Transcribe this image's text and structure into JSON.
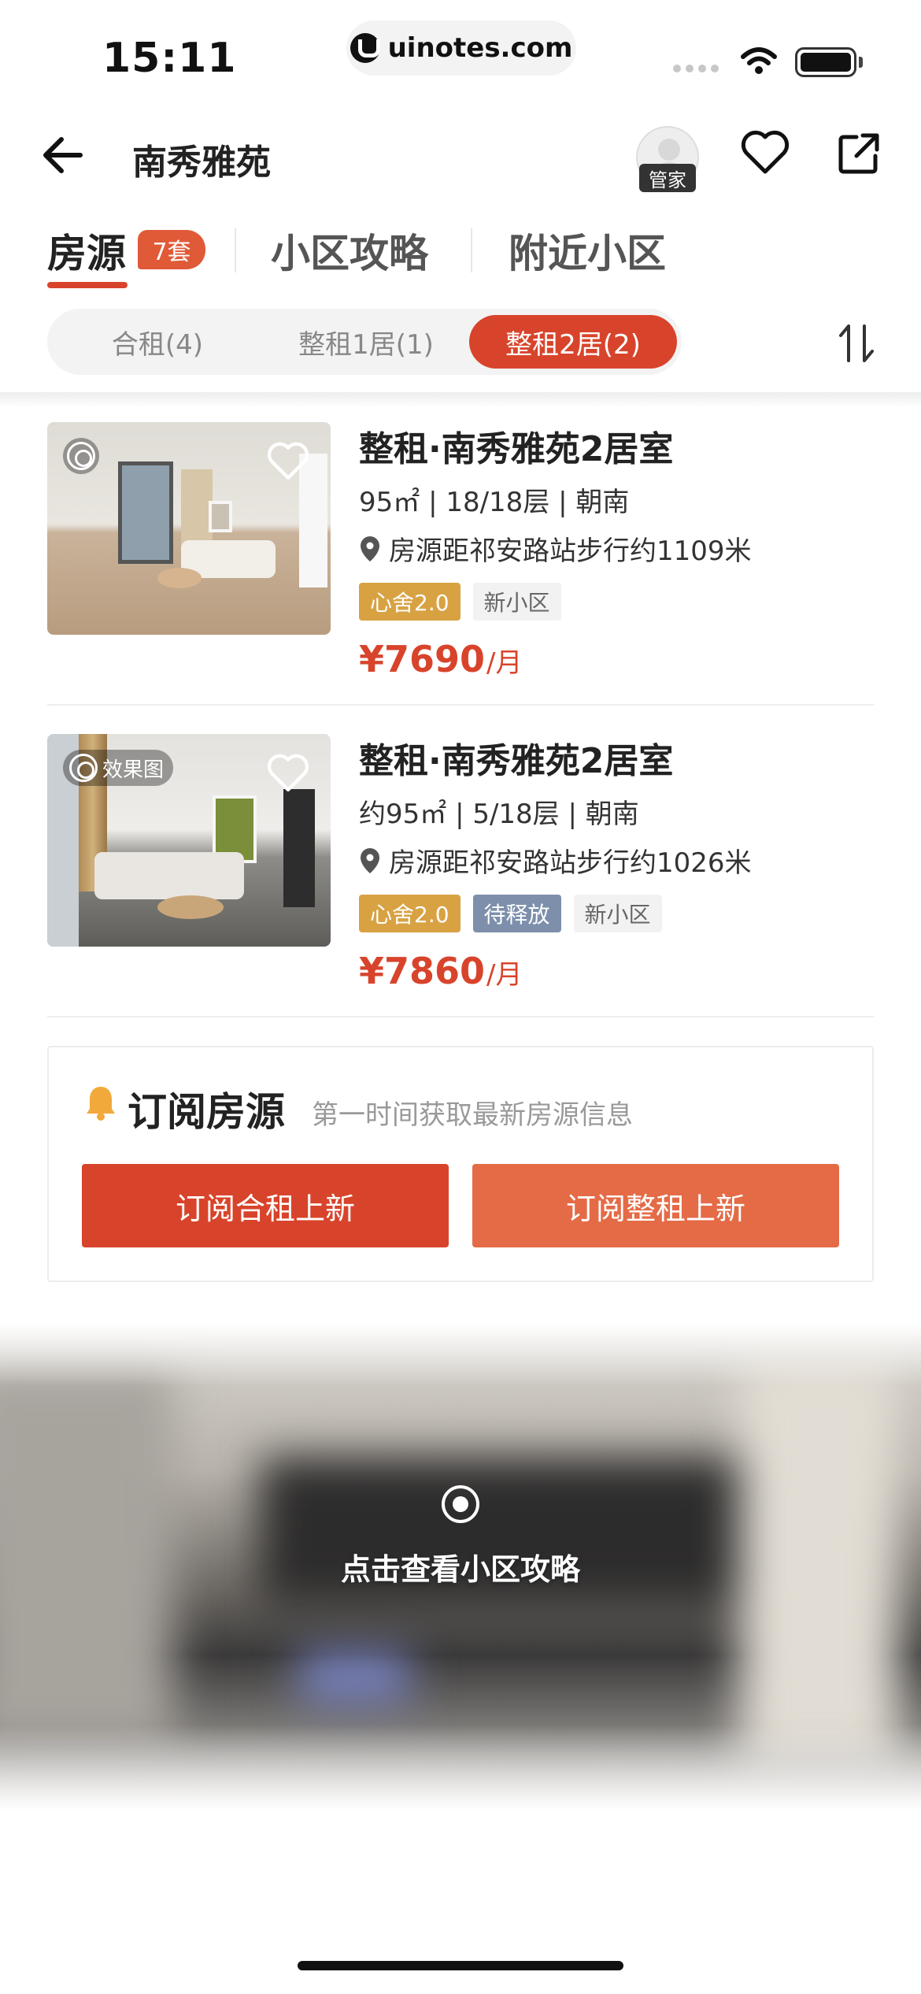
{
  "status_bar": {
    "time": "15:11",
    "url": "uinotes.com"
  },
  "header": {
    "title": "南秀雅苑",
    "avatar_badge": "管家"
  },
  "tabs": [
    {
      "label": "房源",
      "badge": "7套",
      "active": true
    },
    {
      "label": "小区攻略",
      "active": false
    },
    {
      "label": "附近小区",
      "active": false
    }
  ],
  "filters": [
    {
      "label": "合租(4)",
      "active": false
    },
    {
      "label": "整租1居(1)",
      "active": false
    },
    {
      "label": "整租2居(2)",
      "active": true
    }
  ],
  "listings": [
    {
      "title": "整租·南秀雅苑2居室",
      "meta": "95㎡ | 18/18层 | 朝南",
      "location": "房源距祁安路站步行约1109米",
      "image_chip": "",
      "tags": [
        "心舍2.0",
        "新小区"
      ],
      "price": "¥7690",
      "price_unit": "/月"
    },
    {
      "title": "整租·南秀雅苑2居室",
      "meta": "约95㎡ | 5/18层 | 朝南",
      "location": "房源距祁安路站步行约1026米",
      "image_chip": "效果图",
      "tags": [
        "心舍2.0",
        "待释放",
        "新小区"
      ],
      "price": "¥7860",
      "price_unit": "/月"
    }
  ],
  "subscribe": {
    "title": "订阅房源",
    "description": "第一时间获取最新房源信息",
    "btn_shared": "订阅合租上新",
    "btn_whole": "订阅整租上新"
  },
  "guide_banner": {
    "text": "点击查看小区攻略"
  },
  "colors": {
    "accent": "#d8442b",
    "accent_light": "#e46b46",
    "gold_tag": "#d8a243",
    "blue_tag": "#7d8fab"
  }
}
